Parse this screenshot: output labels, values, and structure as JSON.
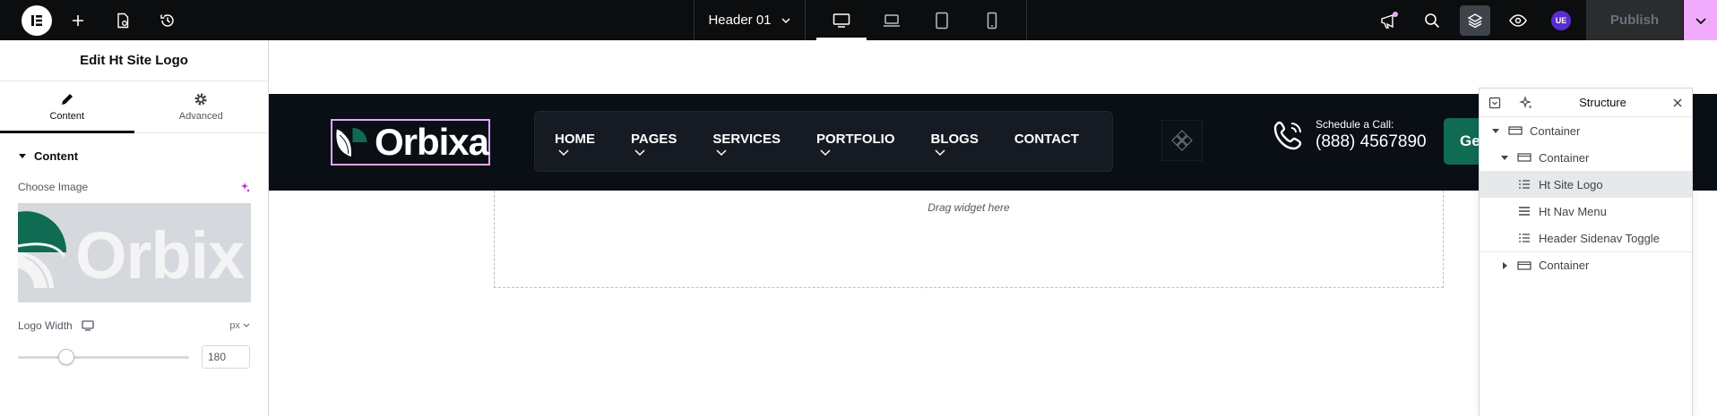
{
  "topbar": {
    "document_title": "Header 01",
    "publish_label": "Publish",
    "avatar_initials": "UE"
  },
  "panel": {
    "title": "Edit Ht Site Logo",
    "tabs": [
      {
        "label": "Content",
        "icon": "pencil-icon",
        "active": true
      },
      {
        "label": "Advanced",
        "icon": "gear-icon",
        "active": false
      }
    ],
    "section_title": "Content",
    "choose_image_label": "Choose Image",
    "preview_logo_text": "Orbix",
    "logo_width_label": "Logo Width",
    "logo_width_unit": "px",
    "logo_width_value": "180",
    "logo_width_slider_fraction": 0.28
  },
  "canvas": {
    "logo_text": "Orbixa",
    "nav": [
      {
        "label": "HOME",
        "dropdown": true
      },
      {
        "label": "PAGES",
        "dropdown": true
      },
      {
        "label": "SERVICES",
        "dropdown": true
      },
      {
        "label": "PORTFOLIO",
        "dropdown": true
      },
      {
        "label": "BLOGS",
        "dropdown": true
      },
      {
        "label": "CONTACT",
        "dropdown": false
      }
    ],
    "call_small": "Schedule a Call:",
    "call_number": "(888) 4567890",
    "cta_label": "Ge",
    "drop_hint": "Drag widget here"
  },
  "structure": {
    "title": "Structure",
    "items": [
      {
        "label": "Container",
        "level": 0,
        "toggle": "expanded",
        "icon": "container-icon",
        "selected": false
      },
      {
        "label": "Container",
        "level": 1,
        "toggle": "expanded",
        "icon": "container-icon",
        "selected": false
      },
      {
        "label": "Ht Site Logo",
        "level": 2,
        "toggle": "none",
        "icon": "widget-list-icon",
        "selected": true
      },
      {
        "label": "Ht Nav Menu",
        "level": 2,
        "toggle": "none",
        "icon": "menu-icon",
        "selected": false
      },
      {
        "label": "Header Sidenav Toggle",
        "level": 2,
        "toggle": "none",
        "icon": "widget-list-icon",
        "selected": false
      },
      {
        "label": "Container",
        "level": 1,
        "toggle": "collapsed",
        "icon": "container-icon",
        "selected": false
      }
    ]
  },
  "colors": {
    "topbar_bg": "#0c0d0e",
    "accent_pink": "#f0abfc",
    "brand_green": "#0f6b52",
    "header_bg": "#0a0e15"
  }
}
